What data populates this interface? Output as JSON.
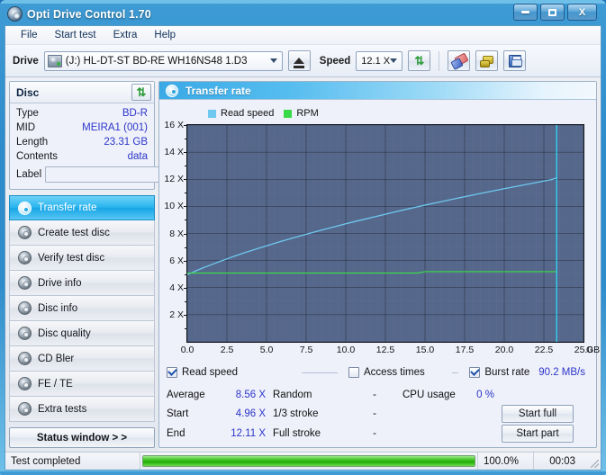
{
  "window": {
    "title": "Opti Drive Control 1.70",
    "icon": "disc-icon",
    "minimize_label": "",
    "maximize_label": "",
    "close_label": "X"
  },
  "menu": {
    "items": [
      {
        "label": "File"
      },
      {
        "label": "Start test"
      },
      {
        "label": "Extra"
      },
      {
        "label": "Help"
      }
    ]
  },
  "toolbar": {
    "drive_label": "Drive",
    "drive_value": "(J:)  HL-DT-ST BD-RE  WH16NS48 1.D3",
    "eject_icon": "eject-icon",
    "speed_label": "Speed",
    "speed_value": "12.1 X",
    "refresh_icon": "refresh-icon",
    "erase_icon": "erase-icon",
    "firmware_icon": "plug-icon",
    "save_icon": "save-icon"
  },
  "disc_panel": {
    "title": "Disc",
    "refresh_icon": "refresh-icon",
    "rows": [
      {
        "key": "Type",
        "value": "BD-R"
      },
      {
        "key": "MID",
        "value": "MEIRA1 (001)"
      },
      {
        "key": "Length",
        "value": "23.31 GB"
      },
      {
        "key": "Contents",
        "value": "data"
      }
    ],
    "label_key": "Label",
    "label_value": "",
    "label_placeholder": "",
    "disc_icon": "cd-icon"
  },
  "nav": {
    "items": [
      {
        "label": "Transfer rate",
        "icon": "disc-icon",
        "active": true
      },
      {
        "label": "Create test disc",
        "icon": "disc-icon",
        "active": false
      },
      {
        "label": "Verify test disc",
        "icon": "disc-icon",
        "active": false
      },
      {
        "label": "Drive info",
        "icon": "disc-icon",
        "active": false
      },
      {
        "label": "Disc info",
        "icon": "disc-icon",
        "active": false
      },
      {
        "label": "Disc quality",
        "icon": "disc-icon",
        "active": false
      },
      {
        "label": "CD Bler",
        "icon": "disc-icon",
        "active": false
      },
      {
        "label": "FE / TE",
        "icon": "disc-icon",
        "active": false
      },
      {
        "label": "Extra tests",
        "icon": "disc-icon",
        "active": false
      }
    ],
    "status_window_label": "Status window > >"
  },
  "main": {
    "title": "Transfer rate",
    "icon": "disc-icon"
  },
  "chart_data": {
    "type": "line",
    "title": "Transfer rate",
    "xlabel": "GB",
    "ylabel": "X",
    "x_unit": "GB",
    "xlim": [
      0.0,
      25.0
    ],
    "ylim": [
      0,
      16
    ],
    "x_ticks": [
      "0.0",
      "2.5",
      "5.0",
      "7.5",
      "10.0",
      "12.5",
      "15.0",
      "17.5",
      "20.0",
      "22.5",
      "25.0"
    ],
    "x_tick_values": [
      0.0,
      2.5,
      5.0,
      7.5,
      10.0,
      12.5,
      15.0,
      17.5,
      20.0,
      22.5,
      25.0
    ],
    "y_ticks": [
      "2 X",
      "4 X",
      "6 X",
      "8 X",
      "10 X",
      "12 X",
      "14 X",
      "16 X"
    ],
    "y_tick_values": [
      2,
      4,
      6,
      8,
      10,
      12,
      14,
      16
    ],
    "grid": true,
    "legend_position": "top-left",
    "plot_bg": "#55678a",
    "series": [
      {
        "name": "Read speed",
        "color": "#6ec8f0",
        "x": [
          0.0,
          0.5,
          1.0,
          1.5,
          2.0,
          2.5,
          3.0,
          3.5,
          4.0,
          5.0,
          6.0,
          7.0,
          8.0,
          9.0,
          10.0,
          11.0,
          12.0,
          13.0,
          14.0,
          15.0,
          16.0,
          17.0,
          18.0,
          19.0,
          20.0,
          21.0,
          22.0,
          23.0,
          23.31
        ],
        "values": [
          4.96,
          5.22,
          5.46,
          5.69,
          5.91,
          6.12,
          6.33,
          6.53,
          6.72,
          7.09,
          7.44,
          7.78,
          8.1,
          8.41,
          8.71,
          9.0,
          9.28,
          9.56,
          9.83,
          10.09,
          10.34,
          10.59,
          10.83,
          11.07,
          11.3,
          11.53,
          11.75,
          11.98,
          12.11
        ]
      },
      {
        "name": "RPM",
        "color": "#39d94a",
        "x": [
          0.0,
          5.0,
          10.0,
          14.5,
          15.0,
          20.0,
          23.31
        ],
        "values": [
          5.08,
          5.08,
          5.08,
          5.08,
          5.18,
          5.18,
          5.18
        ]
      }
    ],
    "markers": [
      {
        "name": "end-of-data",
        "x": 23.31,
        "color": "#2fd0f5",
        "orientation": "vertical"
      }
    ],
    "legend": [
      {
        "label": "Read speed",
        "color": "#6ec8f0"
      },
      {
        "label": "RPM",
        "color": "#39d94a"
      }
    ]
  },
  "options": {
    "read_speed": {
      "label": "Read speed",
      "checked": true
    },
    "access_times": {
      "label": "Access times",
      "checked": false
    },
    "burst_rate": {
      "label": "Burst rate",
      "checked": true,
      "value": "90.2 MB/s"
    }
  },
  "stats": {
    "rows": [
      {
        "key": "Average",
        "value": "8.56 X",
        "key2": "Random",
        "value2": "-",
        "key3": "CPU usage",
        "value3": "0 %"
      },
      {
        "key": "Start",
        "value": "4.96 X",
        "key2": "1/3 stroke",
        "value2": "-"
      },
      {
        "key": "End",
        "value": "12.11 X",
        "key2": "Full stroke",
        "value2": "-"
      }
    ],
    "start_full_label": "Start full",
    "start_part_label": "Start part"
  },
  "statusbar": {
    "text": "Test completed",
    "percent_label": "100.0%",
    "percent_value": 100,
    "time": "00:03"
  }
}
